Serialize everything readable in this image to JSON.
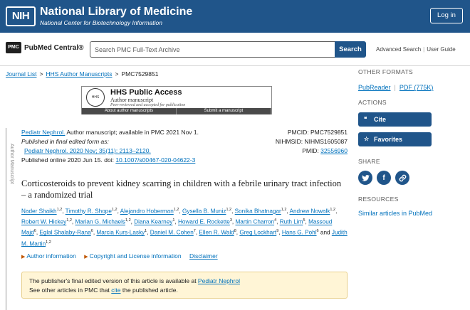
{
  "header": {
    "nih_logo": "NIH",
    "title": "National Library of Medicine",
    "subtitle": "National Center for Biotechnology Information",
    "login_label": "Log in"
  },
  "search": {
    "logo_mark": "PMC",
    "logo_text": "PubMed Central®",
    "placeholder": "Search PMC Full-Text Archive",
    "button_label": "Search",
    "advanced_label": "Advanced Search",
    "guide_label": "User Guide",
    "separator": "|"
  },
  "breadcrumb": {
    "items": [
      "Journal List",
      "HHS Author Manuscripts",
      "PMC7529851"
    ],
    "separator": ">"
  },
  "hhs_banner": {
    "title": "HHS Public Access",
    "subtitle": "Author manuscript",
    "note": "Peer-reviewed and accepted for publication",
    "link_about": "About author manuscripts",
    "link_submit": "Submit a manuscript"
  },
  "side_rail_label": "Author Manuscript",
  "citation": {
    "journal_link": "Pediatr Nephrol.",
    "availability": " Author manuscript; available in PMC 2021 Nov 1.",
    "published_final": "Published in final edited form as:",
    "ref_link": "Pediatr Nephrol. 2020 Nov; 35(11): 2113–2120.",
    "online_prefix": "Published online 2020 Jun 15. doi: ",
    "doi_link": "10.1007/s00467-020-04622-3"
  },
  "identifiers": {
    "pmcid": "PMCID: PMC7529851",
    "nihmsid": "NIHMSID: NIHMS1605087",
    "pmid_label": "PMID: ",
    "pmid_value": "32556960"
  },
  "article": {
    "title": "Corticosteroids to prevent kidney scarring in children with a febrile urinary tract infection – a randomized trial"
  },
  "authors": [
    {
      "name": "Nader Shaikh",
      "aff": "1,2"
    },
    {
      "name": "Timothy R. Shope",
      "aff": "1,2"
    },
    {
      "name": "Alejandro Hoberman",
      "aff": "1,2"
    },
    {
      "name": "Gysella B. Muniz",
      "aff": "1,2"
    },
    {
      "name": "Sonika Bhatnagar",
      "aff": "1,2"
    },
    {
      "name": "Andrew Nowalk",
      "aff": "1,2"
    },
    {
      "name": "Robert W. Hickey",
      "aff": "1,2"
    },
    {
      "name": "Marian G. Michaels",
      "aff": "1,2"
    },
    {
      "name": "Diana Kearney",
      "aff": "1"
    },
    {
      "name": "Howard E. Rockette",
      "aff": "3"
    },
    {
      "name": "Martin Charron",
      "aff": "4"
    },
    {
      "name": "Ruth Lim",
      "aff": "5"
    },
    {
      "name": "Massoud Majd",
      "aff": "6"
    },
    {
      "name": "Eglal Shalaby-Rana",
      "aff": "6"
    },
    {
      "name": "Marcia Kurs-Lasky",
      "aff": "1"
    },
    {
      "name": "Daniel M. Cohen",
      "aff": "7"
    },
    {
      "name": "Ellen R. Wald",
      "aff": "8"
    },
    {
      "name": "Greg Lockhart",
      "aff": "9"
    },
    {
      "name": "Hans G. Pohl",
      "aff": "6"
    },
    {
      "name": "Judith M. Martin",
      "aff": "1,2"
    }
  ],
  "authors_and": "and",
  "info_links": {
    "author_info": "Author information",
    "copyright": "Copyright and License information",
    "disclaimer": "Disclaimer"
  },
  "notice": {
    "line1_prefix": "The publisher's final edited version of this article is available at ",
    "line1_link": "Pediatr Nephrol",
    "line2_prefix": "See other articles in PMC that ",
    "line2_link": "cite",
    "line2_suffix": " the published article."
  },
  "sidebar": {
    "other_formats_heading": "OTHER FORMATS",
    "pubreader": "PubReader",
    "pdf": "PDF (775K)",
    "actions_heading": "ACTIONS",
    "cite_label": "Cite",
    "favorites_label": "Favorites",
    "share_heading": "SHARE",
    "resources_heading": "RESOURCES",
    "similar_articles": "Similar articles in PubMed"
  },
  "colors": {
    "nih_blue": "#20558a",
    "link_blue": "#0071bc",
    "notice_bg": "#fff5d6"
  }
}
